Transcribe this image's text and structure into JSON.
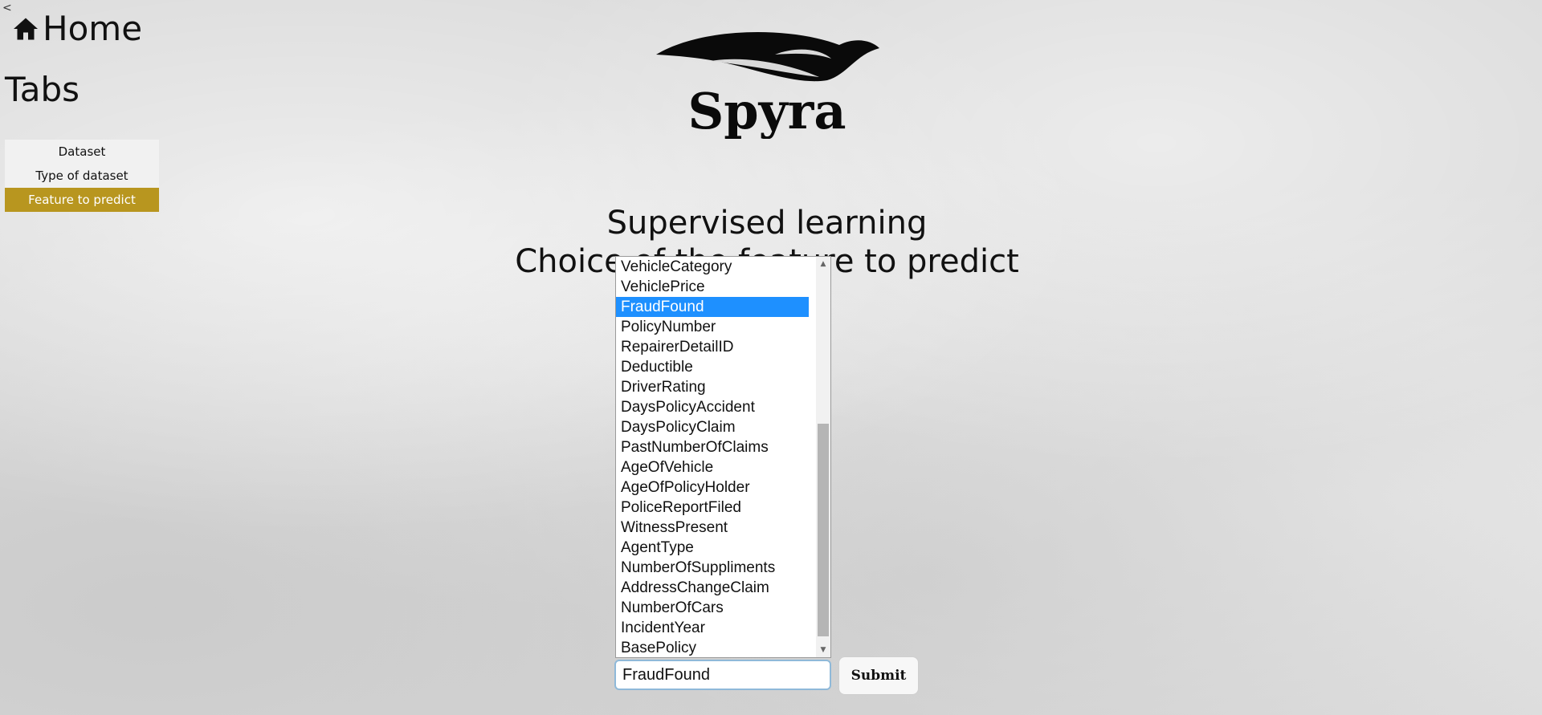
{
  "nav": {
    "back_symbol": "<",
    "home_label": "Home",
    "home_icon": "home-icon"
  },
  "sidebar": {
    "title": "Tabs",
    "items": [
      {
        "label": "Dataset",
        "active": false
      },
      {
        "label": "Type of dataset",
        "active": false
      },
      {
        "label": "Feature to predict",
        "active": true
      }
    ],
    "active_color": "#b8961f"
  },
  "logo": {
    "text": "Spyra"
  },
  "main": {
    "title_line1": "Supervised learning",
    "title_line2": "Choice of the feature to predict"
  },
  "feature_list": {
    "options": [
      "VehicleCategory",
      "VehiclePrice",
      "FraudFound",
      "PolicyNumber",
      "RepairerDetailID",
      "Deductible",
      "DriverRating",
      "DaysPolicyAccident",
      "DaysPolicyClaim",
      "PastNumberOfClaims",
      "AgeOfVehicle",
      "AgeOfPolicyHolder",
      "PoliceReportFiled",
      "WitnessPresent",
      "AgentType",
      "NumberOfSuppliments",
      "AddressChangeClaim",
      "NumberOfCars",
      "IncidentYear",
      "BasePolicy"
    ],
    "selected": "FraudFound",
    "highlight_color": "#1e90ff"
  },
  "form": {
    "input_value": "FraudFound",
    "submit_label": "Submit"
  }
}
